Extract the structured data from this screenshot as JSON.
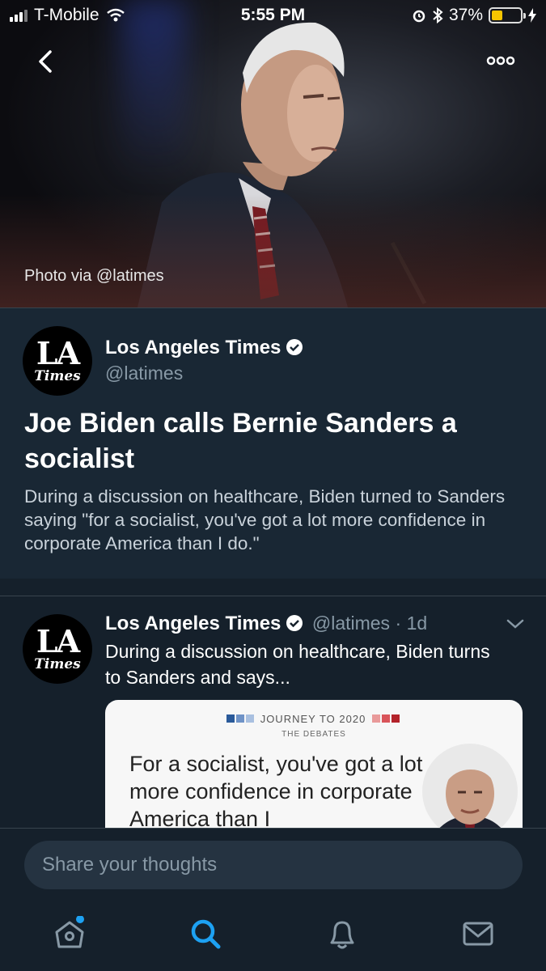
{
  "status_bar": {
    "carrier": "T-Mobile",
    "time": "5:55 PM",
    "battery_percent": "37%",
    "battery_level": 0.37
  },
  "hero": {
    "photo_credit": "Photo via @latimes"
  },
  "story": {
    "account_name": "Los Angeles Times",
    "account_handle": "@latimes",
    "headline": "Joe Biden calls Bernie Sanders a socialist",
    "summary": "During a discussion on healthcare, Biden turned to Sanders saying \"for a socialist, you've got a lot more confidence in corporate America than I do.\""
  },
  "tweet": {
    "account_name": "Los Angeles Times",
    "account_handle": "@latimes",
    "separator": "·",
    "time_ago": "1d",
    "text": "During a discussion on healthcare, Biden turns to Sanders and says...",
    "media": {
      "series": "JOURNEY TO 2020",
      "subtitle": "THE DEBATES",
      "quote": "For a socialist, you've got a lot more confidence in corporate America than I"
    }
  },
  "compose": {
    "placeholder": "Share your thoughts"
  },
  "avatar_text": {
    "la": "LA",
    "times": "Times"
  },
  "colors": {
    "background": "#15202b",
    "card": "#192734",
    "accent": "#1da1f2",
    "muted": "#8899a6"
  },
  "tabs": [
    "home",
    "search",
    "notifications",
    "messages"
  ],
  "active_tab": "search"
}
